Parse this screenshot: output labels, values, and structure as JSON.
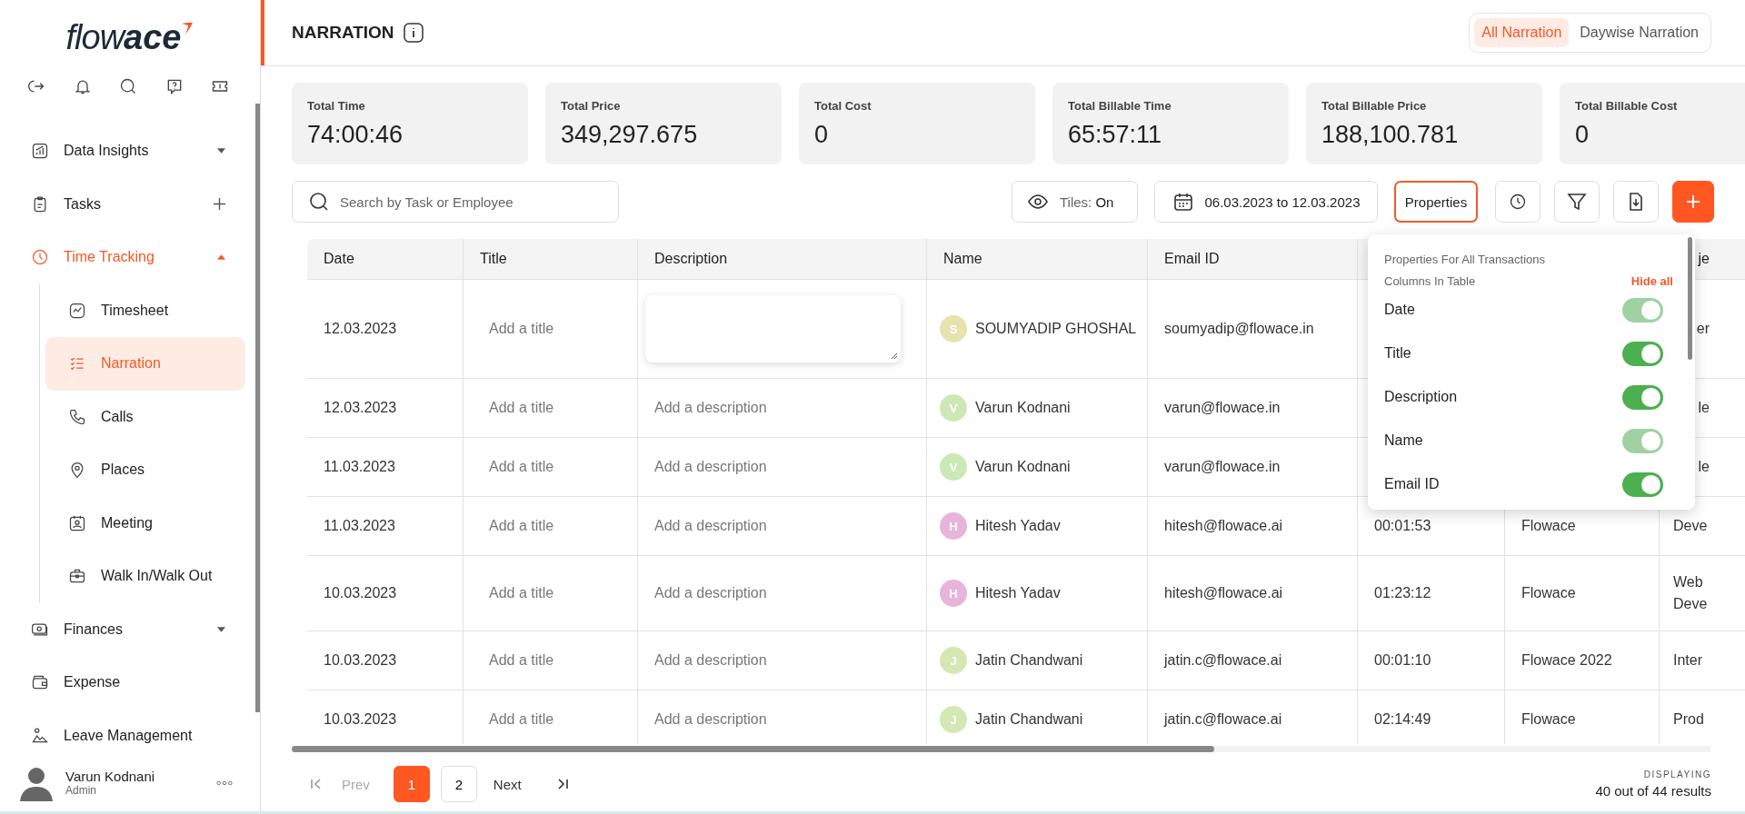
{
  "sidebar": {
    "logo": {
      "light": "flow",
      "bold": "ace"
    },
    "nav": [
      {
        "label": "Data Insights",
        "kind": "group",
        "expanded": false,
        "selected": false
      },
      {
        "label": "Tasks",
        "kind": "action",
        "selected": false
      },
      {
        "label": "Time Tracking",
        "kind": "group",
        "expanded": true,
        "selected": true,
        "children": [
          {
            "label": "Timesheet",
            "selected": false
          },
          {
            "label": "Narration",
            "selected": true
          },
          {
            "label": "Calls",
            "selected": false
          },
          {
            "label": "Places",
            "selected": false
          },
          {
            "label": "Meeting",
            "selected": false
          },
          {
            "label": "Walk In/Walk Out",
            "selected": false
          }
        ]
      },
      {
        "label": "Finances",
        "kind": "group",
        "expanded": false,
        "selected": false
      },
      {
        "label": "Expense",
        "kind": "link",
        "selected": false
      },
      {
        "label": "Leave Management",
        "kind": "link",
        "selected": false
      }
    ],
    "user": {
      "name": "Varun Kodnani",
      "role": "Admin"
    }
  },
  "header": {
    "title": "NARRATION",
    "view_tabs": [
      {
        "label": "All Narration",
        "selected": true
      },
      {
        "label": "Daywise Narration",
        "selected": false
      }
    ]
  },
  "stats": [
    {
      "label": "Total Time",
      "value": "74:00:46"
    },
    {
      "label": "Total Price",
      "value": "349,297.675"
    },
    {
      "label": "Total Cost",
      "value": "0"
    },
    {
      "label": "Total Billable Time",
      "value": "65:57:11"
    },
    {
      "label": "Total Billable Price",
      "value": "188,100.781"
    },
    {
      "label": "Total Billable Cost",
      "value": "0"
    }
  ],
  "toolbar": {
    "search": {
      "placeholder": "Search by Task or Employee"
    },
    "tiles": {
      "label": "Tiles:",
      "value": "On"
    },
    "date_range": "06.03.2023 to 12.03.2023",
    "properties": {
      "label": "Properties",
      "selected": true
    }
  },
  "table": {
    "columns": [
      "Date",
      "Title",
      "Description",
      "Name",
      "Email ID",
      null,
      null,
      "je"
    ],
    "rows": [
      {
        "date": "12.03.2023",
        "title_placeholder": "Add a title",
        "description": {
          "editing": true
        },
        "name": "SOUMYADIP GHOSHAL",
        "initial": "S",
        "color": "#e8e2b0",
        "email": "soumyadip@flowace.in",
        "time": null,
        "project": null,
        "column_8": "er"
      },
      {
        "date": "12.03.2023",
        "title_placeholder": "Add a title",
        "description": {
          "editing": false,
          "placeholder": "Add a description"
        },
        "name": "Varun Kodnani",
        "initial": "V",
        "color": "#cce8b4",
        "email": "varun@flowace.in",
        "time": null,
        "project": null,
        "column_8": "le"
      },
      {
        "date": "11.03.2023",
        "title_placeholder": "Add a title",
        "description": {
          "editing": false,
          "placeholder": "Add a description"
        },
        "name": "Varun Kodnani",
        "initial": "V",
        "color": "#cce8b4",
        "email": "varun@flowace.in",
        "time": null,
        "project": null,
        "column_8": "le"
      },
      {
        "date": "11.03.2023",
        "title_placeholder": "Add a title",
        "description": {
          "editing": false,
          "placeholder": "Add a description"
        },
        "name": "Hitesh Yadav",
        "initial": "H",
        "color": "#e8b4dc",
        "email": "hitesh@flowace.ai",
        "time": "00:01:53",
        "project": "Flowace",
        "column_8": "Deve"
      },
      {
        "date": "10.03.2023",
        "title_placeholder": "Add a title",
        "description": {
          "editing": false,
          "placeholder": "Add a description"
        },
        "name": "Hitesh Yadav",
        "initial": "H",
        "color": "#e8b4dc",
        "email": "hitesh@flowace.ai",
        "time": "01:23:12",
        "project": "Flowace",
        "column_8": "Web Deve"
      },
      {
        "date": "10.03.2023",
        "title_placeholder": "Add a title",
        "description": {
          "editing": false,
          "placeholder": "Add a description"
        },
        "name": "Jatin Chandwani",
        "initial": "J",
        "color": "#d4e8b4",
        "email": "jatin.c@flowace.ai",
        "time": "00:01:10",
        "project": "Flowace 2022",
        "column_8": "Inter"
      },
      {
        "date": "10.03.2023",
        "title_placeholder": "Add a title",
        "description": {
          "editing": false,
          "placeholder": "Add a description"
        },
        "name": "Jatin Chandwani",
        "initial": "J",
        "color": "#d4e8b4",
        "email": "jatin.c@flowace.ai",
        "time": "02:14:49",
        "project": "Flowace",
        "column_8": "Prod"
      }
    ]
  },
  "popover": {
    "title": "Properties For All Transactions",
    "subtitle": "Columns In Table",
    "action": "Hide all",
    "toggles": [
      {
        "label": "Date",
        "on": true,
        "disabled": true
      },
      {
        "label": "Title",
        "on": true,
        "disabled": false
      },
      {
        "label": "Description",
        "on": true,
        "disabled": false
      },
      {
        "label": "Name",
        "on": true,
        "disabled": true
      },
      {
        "label": "Email ID",
        "on": true,
        "disabled": false
      }
    ]
  },
  "pagination": {
    "prev": "Prev",
    "next": "Next",
    "pages": [
      {
        "label": "1",
        "selected": true
      },
      {
        "label": "2",
        "selected": false
      }
    ],
    "displaying": "DISPLAYING",
    "results": "40 out of 44 results"
  }
}
